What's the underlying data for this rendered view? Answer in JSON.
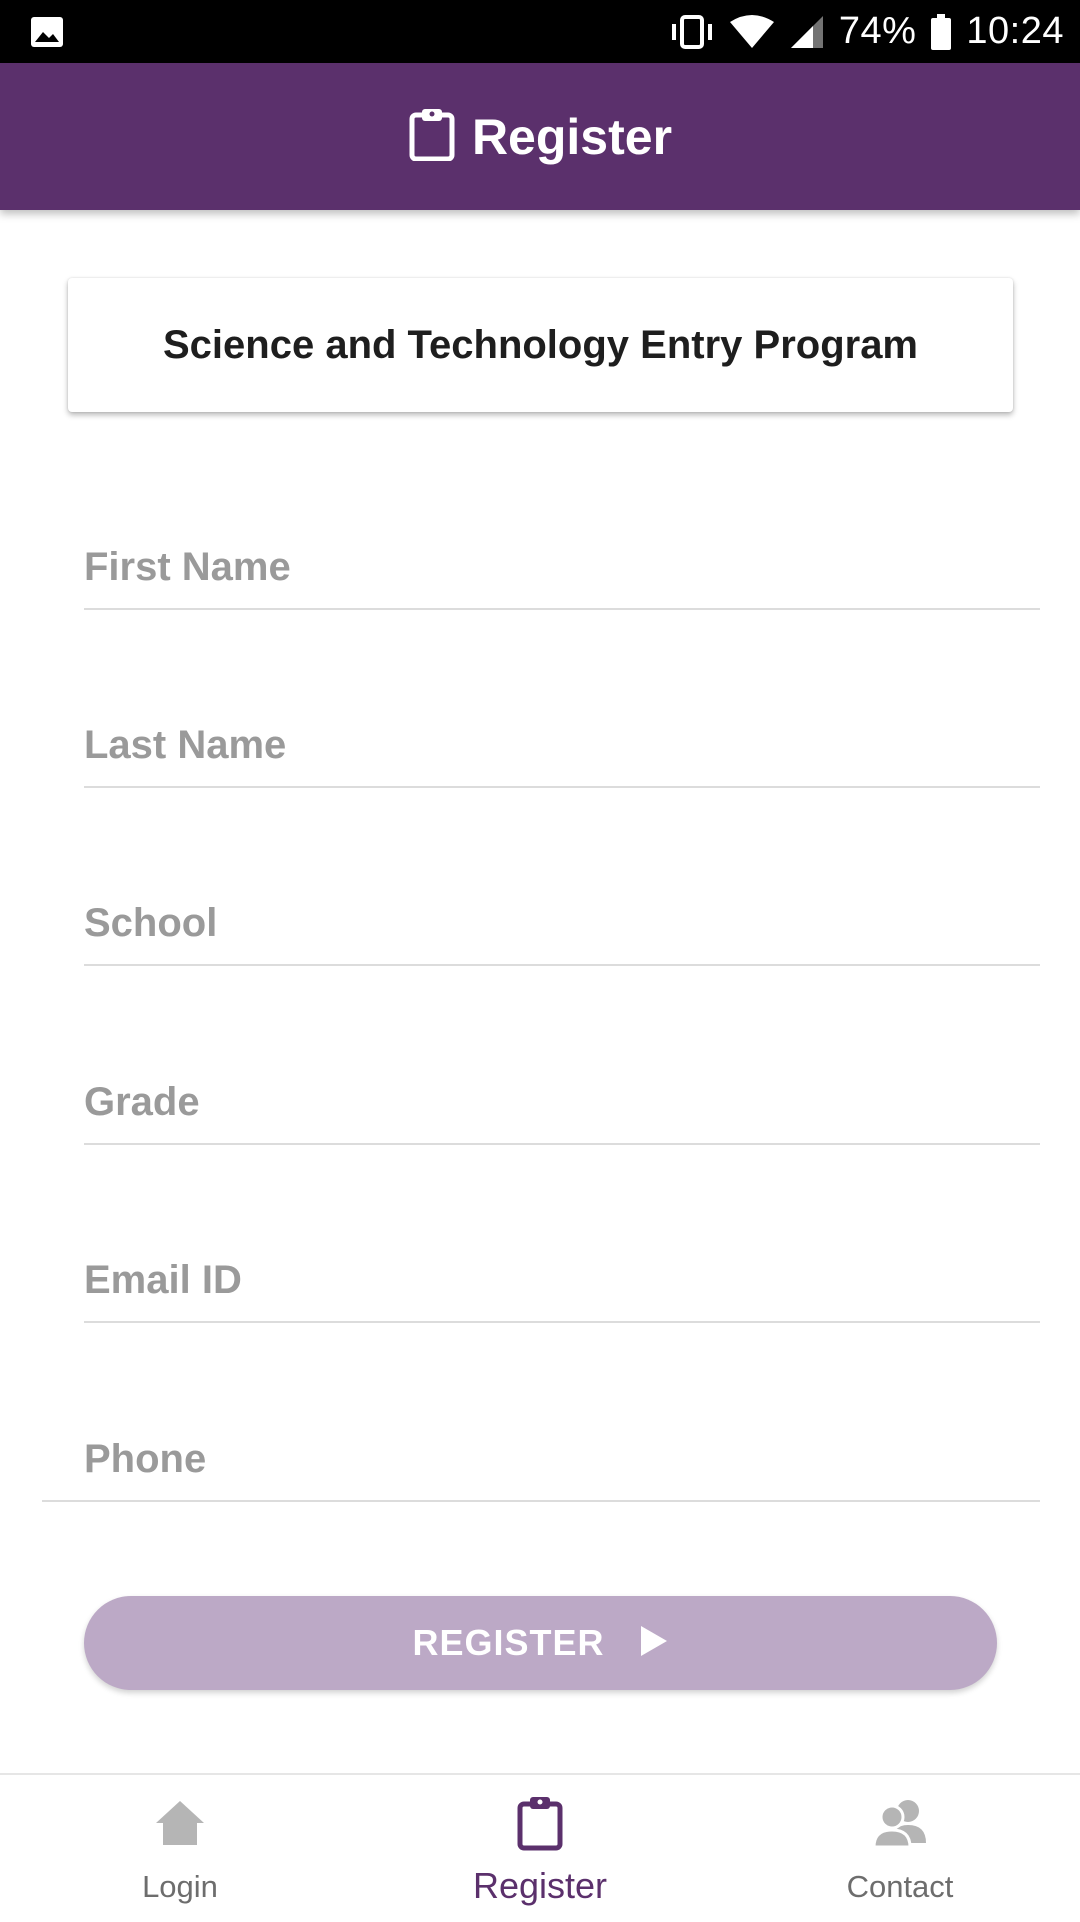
{
  "status_bar": {
    "battery": "74%",
    "time": "10:24",
    "icons": [
      "image-icon",
      "vibrate-icon",
      "wifi-icon",
      "signal-icon",
      "battery-icon"
    ]
  },
  "app_bar": {
    "title": "Register",
    "icon": "clipboard-icon"
  },
  "card": {
    "title": "Science and Technology Entry Program"
  },
  "form": {
    "first_name": {
      "placeholder": "First Name",
      "value": ""
    },
    "last_name": {
      "placeholder": "Last Name",
      "value": ""
    },
    "school": {
      "placeholder": "School",
      "value": ""
    },
    "grade": {
      "placeholder": "Grade",
      "value": ""
    },
    "email": {
      "placeholder": "Email ID",
      "value": ""
    },
    "phone": {
      "placeholder": "Phone",
      "value": ""
    },
    "submit_label": "REGISTER",
    "submit_icon": "play-arrow-icon"
  },
  "bottom_nav": {
    "items": [
      {
        "label": "Login",
        "icon": "home-icon",
        "active": false
      },
      {
        "label": "Register",
        "icon": "clipboard-icon",
        "active": true
      },
      {
        "label": "Contact",
        "icon": "people-icon",
        "active": false
      }
    ]
  },
  "colors": {
    "primary": "#5b306c",
    "button_disabled": "#bca9c6",
    "placeholder": "#9a9a9a",
    "nav_inactive": "#6d6d6d",
    "divider": "#dcdcdc"
  }
}
